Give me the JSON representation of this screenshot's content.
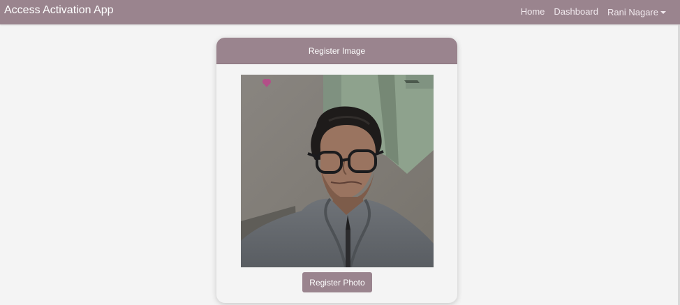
{
  "navbar": {
    "brand": "Access Activation App",
    "links": {
      "home": "Home",
      "dashboard": "Dashboard"
    },
    "user": "Rani Nagare"
  },
  "card": {
    "title": "Register Image",
    "photo_icon": "person-photo",
    "button_label": "Register Photo"
  },
  "colors": {
    "accent": "#9a848e",
    "background": "#f4f4f4",
    "text_on_accent": "#ffffff"
  }
}
